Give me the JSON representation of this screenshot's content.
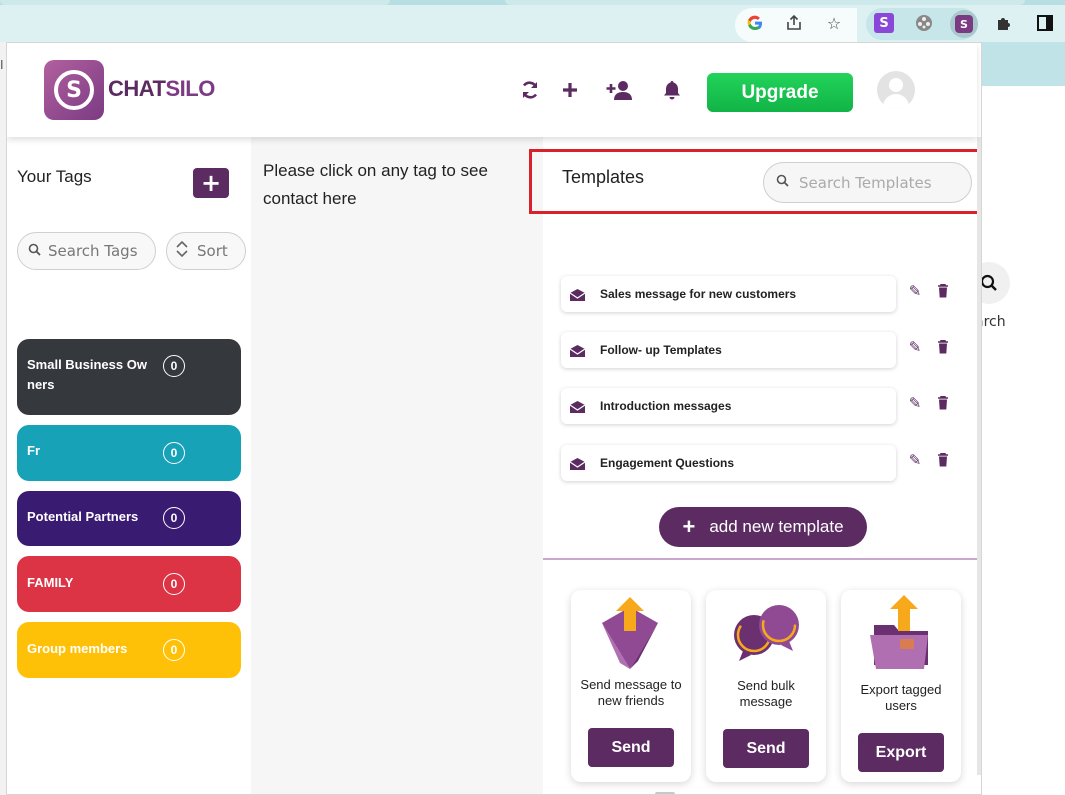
{
  "browser": {
    "icons": [
      "google-icon",
      "share-icon",
      "star-icon",
      "extension-s-icon",
      "film-icon",
      "chatsilo-ext-icon",
      "puzzle-icon",
      "sidepanel-icon"
    ],
    "partial_text": "arch",
    "partial_left_text": "I"
  },
  "header": {
    "brand_first": "CHAT",
    "brand_second": "SILO",
    "logo_glyph": "S",
    "upgrade_label": "Upgrade",
    "icons": [
      "refresh-icon",
      "plus-icon",
      "add-user-icon",
      "bell-icon"
    ]
  },
  "tags_panel": {
    "title": "Your Tags",
    "add_glyph": "+",
    "search_placeholder": "Search Tags",
    "sort_label": "Sort",
    "tags": [
      {
        "name": "Small Business Ow ners",
        "count": "0",
        "color": "#35383d"
      },
      {
        "name": "Fr",
        "count": "0",
        "color": "#18a2b8"
      },
      {
        "name": "Potential Partners",
        "count": "0",
        "color": "#3a1b72"
      },
      {
        "name": "FAMILY",
        "count": "0",
        "color": "#dc3345"
      },
      {
        "name": "Group members",
        "count": "0",
        "color": "#ffc107"
      }
    ]
  },
  "contacts_panel": {
    "message": "Please click on any tag to see contact here"
  },
  "templates_panel": {
    "title": "Templates",
    "search_placeholder": "Search Templates",
    "templates": [
      {
        "name": "Sales message for new customers"
      },
      {
        "name": "Follow- up Templates"
      },
      {
        "name": "Introduction messages"
      },
      {
        "name": "Engagement Questions"
      }
    ],
    "add_label": "add new template",
    "add_glyph": "+"
  },
  "cards": [
    {
      "label": "Send message to new friends",
      "button": "Send"
    },
    {
      "label": "Send bulk message",
      "button": "Send"
    },
    {
      "label": "Export tagged users",
      "button": "Export"
    }
  ],
  "colors": {
    "brand": "#5b2b61",
    "upgrade": "#1cc44f",
    "highlight": "#d9212c"
  }
}
